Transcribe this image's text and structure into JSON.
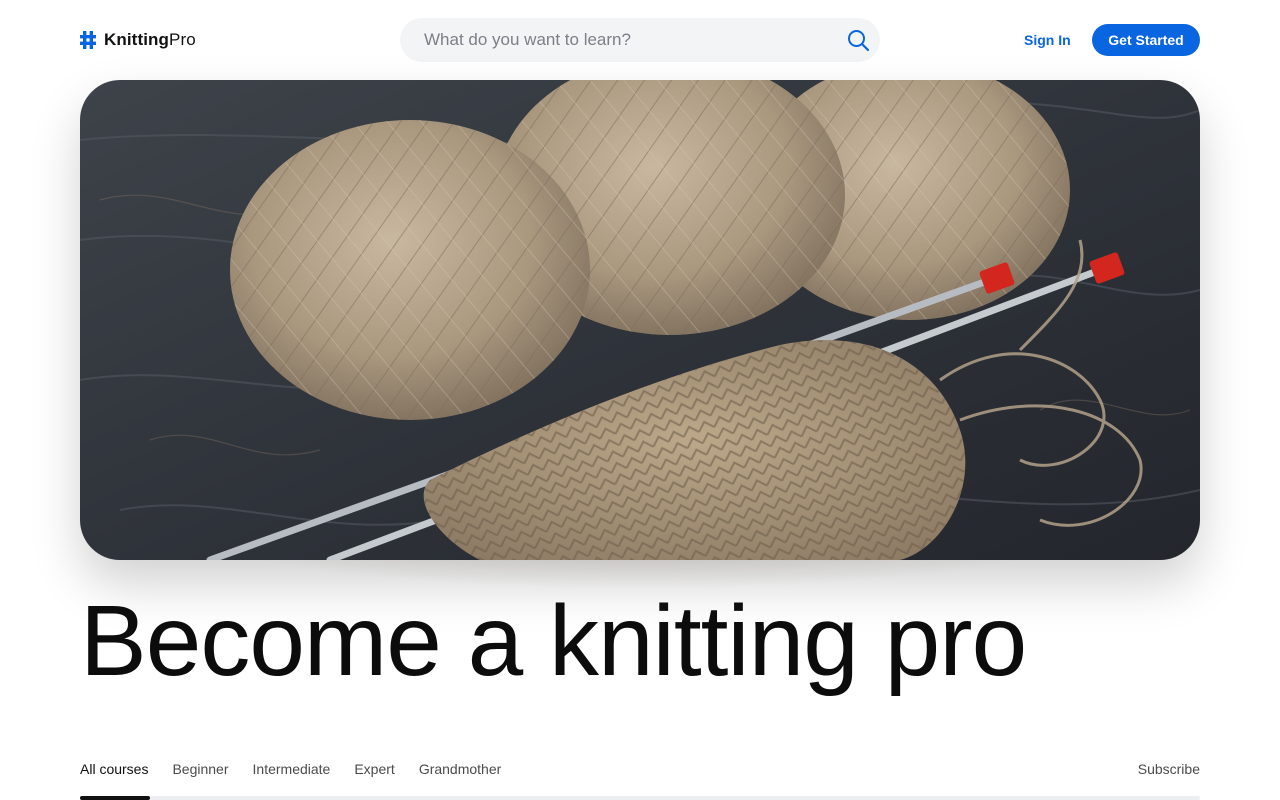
{
  "brand": {
    "bold": "Knitting",
    "light": "Pro",
    "icon": "hash-icon",
    "accent": "#0a66e0"
  },
  "search": {
    "placeholder": "What do you want to learn?",
    "value": "",
    "icon": "search-icon"
  },
  "nav": {
    "sign_in": "Sign In",
    "get_started": "Get Started"
  },
  "hero": {
    "image": "yarn-balls-and-knitting-needles-photo"
  },
  "headline": "Become a knitting pro",
  "tabs": [
    {
      "label": "All courses",
      "active": true
    },
    {
      "label": "Beginner",
      "active": false
    },
    {
      "label": "Intermediate",
      "active": false
    },
    {
      "label": "Expert",
      "active": false
    },
    {
      "label": "Grandmother",
      "active": false
    }
  ],
  "subscribe": "Subscribe",
  "colors": {
    "primary": "#0a66e0",
    "text": "#111111",
    "muted": "#4b4b4b",
    "search_bg": "#f3f4f6"
  }
}
